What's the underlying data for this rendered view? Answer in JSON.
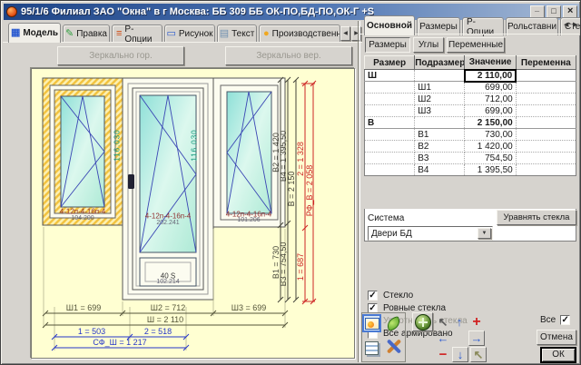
{
  "window": {
    "title": "95/1/6 Филиал ЗАО \"Окна\" в г Москва: ББ 309 ББ ОК-ПО,БД-ПО,ОК-Г +S"
  },
  "main_tabs": {
    "items": [
      {
        "label": "Модель"
      },
      {
        "label": "Правка"
      },
      {
        "label": "Р-Опции"
      },
      {
        "label": "Рисунок"
      },
      {
        "label": "Текст"
      },
      {
        "label": "Производственны"
      }
    ]
  },
  "mirror_buttons": {
    "horizontal": "Зеркально гор.",
    "vertical": "Зеркально вер."
  },
  "drawing": {
    "glass_formula": "4-12п-4-16п-4",
    "codes": {
      "left": "104.200",
      "door": "202.241",
      "right": "101.206",
      "mullion": "116.030",
      "panel_label": "40 S",
      "panel_code": "102.214",
      "panel_code2": "101.206"
    },
    "dims_bottom": {
      "sh1": "Ш1 = 699",
      "sh2": "Ш2 = 712",
      "sh3": "Ш3 = 699",
      "sh": "Ш = 2 110",
      "s1": "1 = 503",
      "s2": "2 = 518",
      "sf": "СФ_Ш = 1 217"
    },
    "dims_right": {
      "v2": "В2 = 1 420",
      "v4": "В4 = 1 395,50",
      "v": "В = 2 150",
      "r2": "2 = 1 328",
      "rf": "РФ_В = 2 058",
      "v1": "В1 = 730",
      "v3": "В3 = 754,50",
      "r1": "1 = 687"
    }
  },
  "right_panel": {
    "tabs": [
      {
        "label": "Основной"
      },
      {
        "label": "Размеры"
      },
      {
        "label": "Р-Опции"
      },
      {
        "label": "Рольставни"
      },
      {
        "label": "Стекл"
      }
    ],
    "sub_buttons": [
      {
        "label": "Размеры"
      },
      {
        "label": "Углы"
      },
      {
        "label": "Переменные"
      }
    ],
    "table": {
      "headers": [
        "Размер",
        "Подразмер",
        "Значение",
        "Переменна"
      ],
      "rows": [
        {
          "size": "Ш",
          "sub": "",
          "value": "2 110,00",
          "var": ""
        },
        {
          "size": "",
          "sub": "Ш1",
          "value": "699,00",
          "var": ""
        },
        {
          "size": "",
          "sub": "Ш2",
          "value": "712,00",
          "var": ""
        },
        {
          "size": "",
          "sub": "Ш3",
          "value": "699,00",
          "var": ""
        },
        {
          "size": "В",
          "sub": "",
          "value": "2 150,00",
          "var": ""
        },
        {
          "size": "",
          "sub": "В1",
          "value": "730,00",
          "var": ""
        },
        {
          "size": "",
          "sub": "В2",
          "value": "1 420,00",
          "var": ""
        },
        {
          "size": "",
          "sub": "В3",
          "value": "754,50",
          "var": ""
        },
        {
          "size": "",
          "sub": "В4",
          "value": "1 395,50",
          "var": ""
        }
      ]
    },
    "system": {
      "label": "Система",
      "value": "Двери БД",
      "equalize_button": "Уравнять стекла"
    },
    "checkboxes": [
      {
        "label": "Стекло",
        "mark": "✓"
      },
      {
        "label": "Ровные стекла",
        "mark": "✓"
      },
      {
        "label": "Уплотнитель стекла",
        "mark": "✓"
      },
      {
        "label": "Все армировано",
        "mark": ""
      }
    ],
    "footer": {
      "all_label": "Все",
      "all_mark": "✓",
      "cancel": "Отмена",
      "ok": "ОК"
    }
  }
}
